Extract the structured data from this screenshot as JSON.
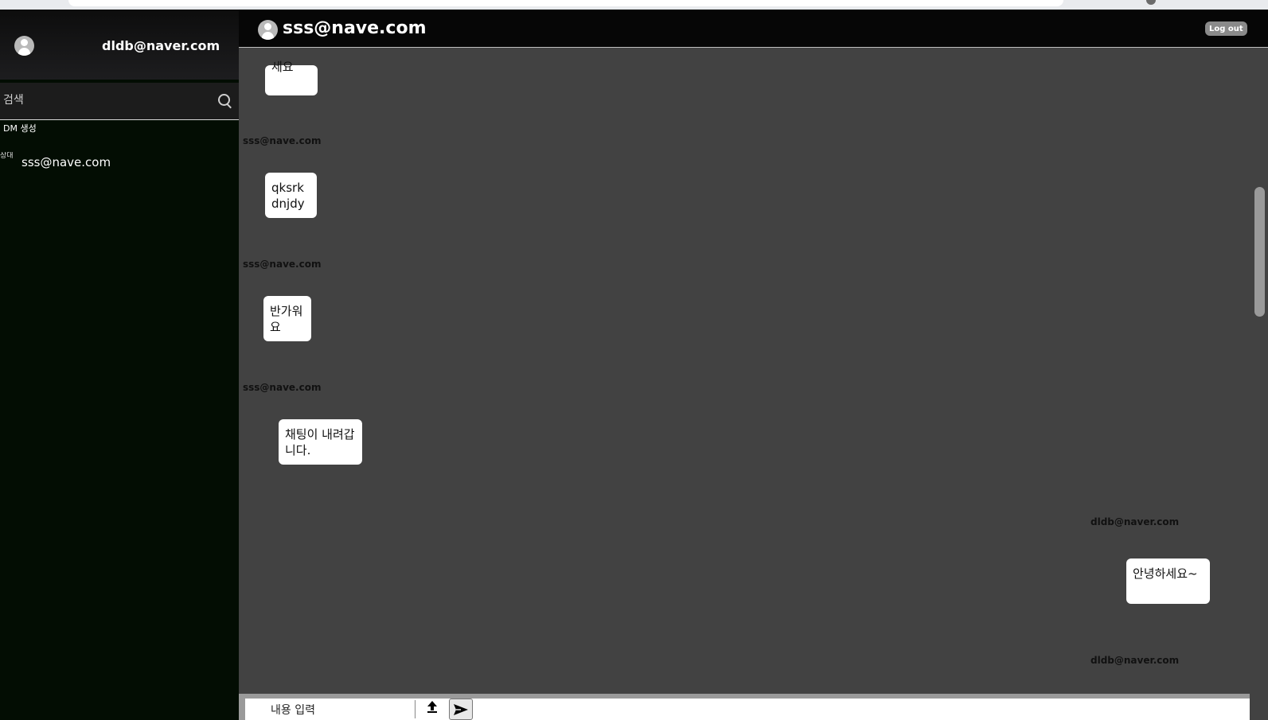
{
  "sidebar": {
    "current_user": "dldb@naver.com",
    "search_placeholder": "검색",
    "dm_create_label": "DM 생성",
    "dm_list": [
      {
        "name": "sss@nave.com",
        "image_alt": "상대"
      }
    ]
  },
  "chat": {
    "peer_name": "sss@nave.com",
    "logout_label": "Log out",
    "messages": [
      {
        "sender": "",
        "text": "세요"
      },
      {
        "sender": "sss@nave.com",
        "text": "qksrkdnjdy"
      },
      {
        "sender": "sss@nave.com",
        "text": "반가워요"
      },
      {
        "sender": "sss@nave.com",
        "text": "채팅이 내려갑니다."
      },
      {
        "sender": "dldb@naver.com",
        "text": "안녕하세요~"
      },
      {
        "sender": "dldb@naver.com",
        "text": ""
      }
    ]
  },
  "composer": {
    "placeholder": "내용 입력",
    "upload_icon": "upload-arrow-icon",
    "send_icon": "send-arrow-icon"
  }
}
